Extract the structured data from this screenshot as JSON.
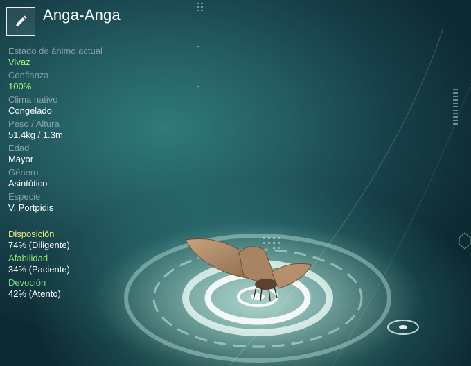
{
  "header": {
    "edit_icon": "pencil-icon",
    "name": "Anga-Anga"
  },
  "stats": [
    {
      "label": "Estado de ánimo actual",
      "value": "Vivaz",
      "value_color": "green"
    },
    {
      "label": "Confianza",
      "value": "100%",
      "value_color": "green"
    },
    {
      "label": "Clima nativo",
      "value": "Congelado",
      "value_color": "white"
    },
    {
      "label": "Peso / Altura",
      "value": "51.4kg / 1.3m",
      "value_color": "white"
    },
    {
      "label": "Edad",
      "value": "Mayor",
      "value_color": "white"
    },
    {
      "label": "Género",
      "value": "Asintótico",
      "value_color": "white"
    },
    {
      "label": "Especie",
      "value": "V. Portpidis",
      "value_color": "white"
    }
  ],
  "traits": [
    {
      "label": "Disposición",
      "value": "74% (Diligente)",
      "label_color": "#e8f07a"
    },
    {
      "label": "Afabilidad",
      "value": "34% (Paciente)",
      "label_color": "#8ee86a"
    },
    {
      "label": "Devoción",
      "value": "42% (Atento)",
      "label_color": "#6ee08a"
    }
  ],
  "colors": {
    "accent_green": "#9dff6a",
    "background": "#1e5558"
  }
}
